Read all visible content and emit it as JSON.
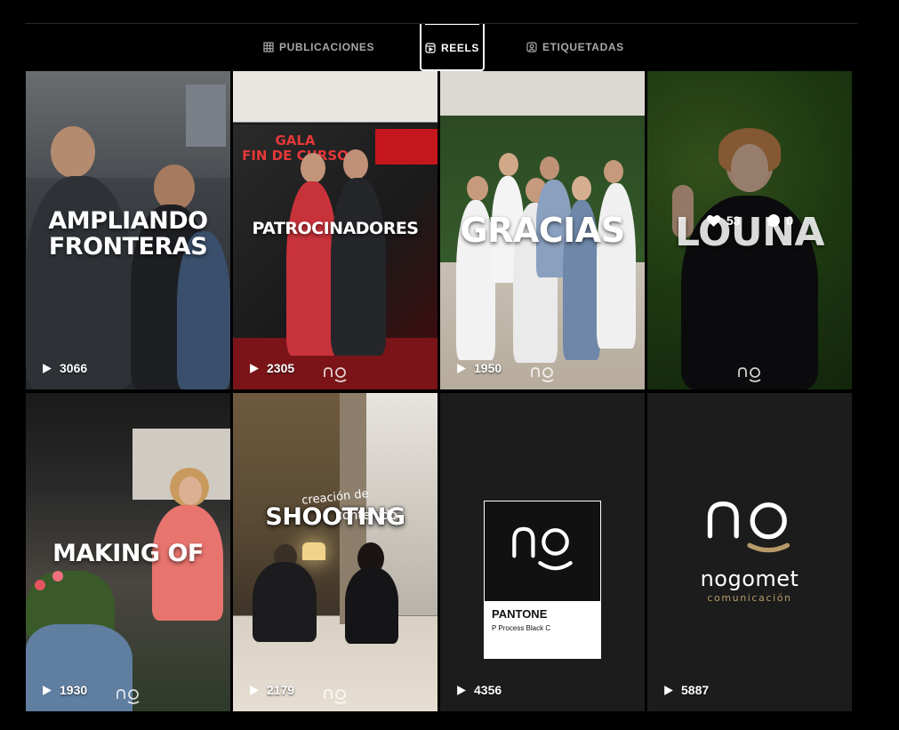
{
  "tabs": [
    {
      "label": "PUBLICACIONES",
      "icon": "grid-icon",
      "active": false
    },
    {
      "label": "REELS",
      "icon": "reels-icon",
      "active": true
    },
    {
      "label": "ETIQUETADAS",
      "icon": "tagged-icon",
      "active": false
    }
  ],
  "reels": [
    {
      "title_lines": [
        "AMPLIANDO",
        "FRONTERAS"
      ],
      "views": "3066"
    },
    {
      "title_lines": [
        "PATROCINADORES"
      ],
      "views": "2305",
      "banner": [
        "GALA",
        "FIN DE CURSO"
      ]
    },
    {
      "title_lines": [
        "GRACIAS"
      ],
      "views": "1950"
    },
    {
      "title_lines": [
        "LOUNA"
      ],
      "views": "",
      "likes": "53",
      "comments": "0"
    },
    {
      "title_lines": [
        "MAKING OF"
      ],
      "views": "1930"
    },
    {
      "title_lines": [
        "SHOOTING"
      ],
      "script_top": "creación de",
      "script_bottom": "contenido",
      "views": "2179"
    },
    {
      "title_lines": [],
      "views": "4356",
      "pantone_title": "PANTONE",
      "pantone_code": "P Process Black C"
    },
    {
      "title_lines": [],
      "views": "5887",
      "brand_name": "nogomet",
      "brand_sub": "comunicación"
    }
  ],
  "colors": {
    "background": "#000000",
    "tab_inactive": "#a8a8a8",
    "brand_gold": "#b89a6a",
    "pantone_bg": "#1c1c1c"
  }
}
